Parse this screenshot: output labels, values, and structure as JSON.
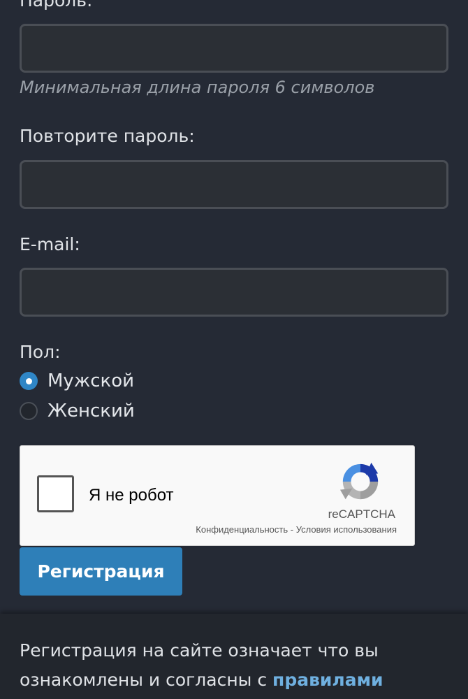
{
  "form": {
    "password_label": "Пароль:",
    "password_value": "",
    "password_hint": "Минимальная длина пароля 6 символов",
    "repeat_password_label": "Повторите пароль:",
    "repeat_password_value": "",
    "email_label": "E-mail:",
    "email_value": "",
    "gender_label": "Пол:",
    "gender_options": [
      {
        "label": "Мужской",
        "checked": true
      },
      {
        "label": "Женский",
        "checked": false
      }
    ]
  },
  "captcha": {
    "checkbox_label": "Я не робот",
    "brand": "reCAPTCHA",
    "privacy_link": "Конфиденциальность",
    "separator": " - ",
    "terms_link": "Условия использования",
    "logo_icon": "recaptcha-logo-icon"
  },
  "register_button": "Регистрация",
  "footer": {
    "text": "Регистрация на сайте означает что вы ознакомлены и согласны с ",
    "rules_link": "правилами"
  },
  "colors": {
    "background": "#252a35",
    "accent": "#2e7fb8",
    "link": "#6fb0e0"
  }
}
